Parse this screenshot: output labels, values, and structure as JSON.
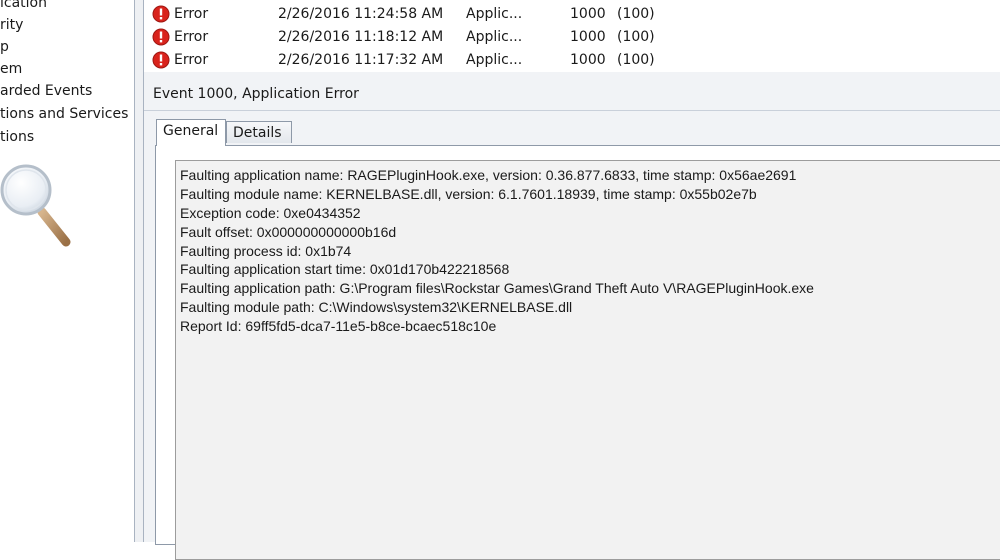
{
  "tree": {
    "items": [
      "ication",
      "rity",
      "p",
      "em",
      "arded Events",
      "tions and Services Lo",
      "tions"
    ]
  },
  "events": [
    {
      "level": "Error",
      "date": "2/26/2016 11:24:58 AM",
      "source": "Applic...",
      "event_id": "1000",
      "task": "(100)"
    },
    {
      "level": "Error",
      "date": "2/26/2016 11:18:12 AM",
      "source": "Applic...",
      "event_id": "1000",
      "task": "(100)"
    },
    {
      "level": "Error",
      "date": "2/26/2016 11:17:32 AM",
      "source": "Applic...",
      "event_id": "1000",
      "task": "(100)"
    }
  ],
  "details": {
    "title": "Event 1000, Application Error",
    "tabs": {
      "general": "General",
      "details": "Details"
    },
    "lines": [
      "Faulting application name: RAGEPluginHook.exe, version: 0.36.877.6833, time stamp: 0x56ae2691",
      "Faulting module name: KERNELBASE.dll, version: 6.1.7601.18939, time stamp: 0x55b02e7b",
      "Exception code: 0xe0434352",
      "Fault offset: 0x000000000000b16d",
      "Faulting process id: 0x1b74",
      "Faulting application start time: 0x01d170b422218568",
      "Faulting application path: G:\\Program files\\Rockstar Games\\Grand Theft Auto V\\RAGEPluginHook.exe",
      "Faulting module path: C:\\Windows\\system32\\KERNELBASE.dll",
      "Report Id: 69ff5fd5-dca7-11e5-b8ce-bcaec518c10e"
    ]
  },
  "icons": {
    "error": "error-icon",
    "magnifier": "magnifier-icon"
  },
  "colors": {
    "error_red": "#d9231c",
    "splitter": "#eef0f3",
    "details_bg": "#f1f3f6"
  }
}
